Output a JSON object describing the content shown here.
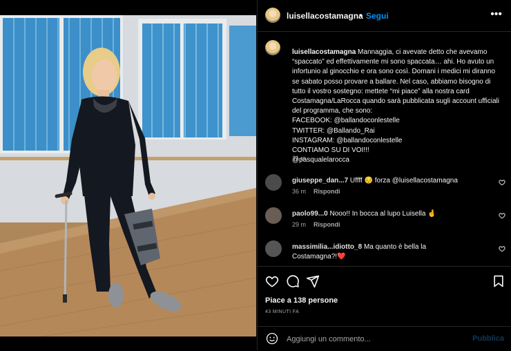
{
  "post": {
    "username": "luisellacostamagna",
    "separator": "•",
    "follow_label": "Segui",
    "more_label": "•••"
  },
  "caption": {
    "username": "luisellacostamagna",
    "text": "Mannaggia, ci avevate detto che avevamo “spaccato” ed effettivamente mi sono spaccata… ahi. Ho avuto un infortunio al ginocchio e ora sono così. Domani i medici mi diranno se sabato posso provare a ballare. Nel caso, abbiamo bisogno di tutto il vostro sostegno: mettete “mi piace” alla nostra card Costamagna/LaRocca quando sarà pubblicata sugli account ufficiali del programma, che sono:\nFACEBOOK: @ballandoconlestelle\nTWITTER: @Ballando_Rai\nINSTAGRAM: @ballandoconlestelle\nCONTIAMO SU DI VOI!!!\n@pasqualelarocca",
    "time": "21 m"
  },
  "comments": [
    {
      "user": "giuseppe_dan...7",
      "text": "Uffff 😔 forza @luisellacostamagna",
      "time": "36 m",
      "reply": "Rispondi"
    },
    {
      "user": "paolo99...0",
      "text": "Nooo!! In bocca al lupo Luisella 🤞",
      "time": "29 m",
      "reply": "Rispondi"
    },
    {
      "user": "massimilia...idiotto_8",
      "text": "Ma quanto è bella la Costamagna?!❤️",
      "time": "",
      "reply": ""
    }
  ],
  "actions": {
    "likes": "Piace a 138 persone",
    "ago": "43 MINUTI FA"
  },
  "add_comment": {
    "placeholder": "Aggiungi un commento...",
    "publish": "Pubblica"
  },
  "colors": {
    "accent": "#0095f6",
    "publish_disabled": "#0f3a5a",
    "background": "#000000",
    "secondary_text": "#a8a8a8"
  }
}
